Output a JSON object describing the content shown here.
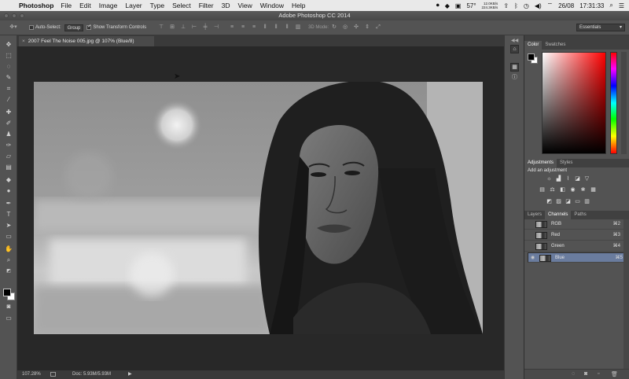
{
  "menubar": {
    "app_name": "Photoshop",
    "items": [
      "File",
      "Edit",
      "Image",
      "Layer",
      "Type",
      "Select",
      "Filter",
      "3D",
      "View",
      "Window",
      "Help"
    ],
    "temperature": "57°",
    "net_up": "12.0KB/s",
    "net_down": "224.3KB/s",
    "date": "26/08",
    "time": "17:31:33"
  },
  "window": {
    "title": "Adobe Photoshop CC 2014"
  },
  "options_bar": {
    "auto_select_label": "Auto-Select:",
    "auto_select_value": "Group",
    "show_transform_label": "Show Transform Controls",
    "mode_3d_label": "3D Mode:",
    "workspace": "Essentials"
  },
  "document": {
    "tab_title": "2007 Feel The Noise 005.jpg @ 107% (Blue/8)",
    "zoom": "107.28%",
    "doc_info": "Doc: 5.93M/5.93M"
  },
  "panels": {
    "color_tabs": [
      "Color",
      "Swatches"
    ],
    "adj_tabs": [
      "Adjustments",
      "Styles"
    ],
    "adj_header": "Add an adjustment",
    "channel_tabs": [
      "Layers",
      "Channels",
      "Paths"
    ],
    "channels": [
      {
        "name": "RGB",
        "shortcut": "⌘2"
      },
      {
        "name": "Red",
        "shortcut": "⌘3"
      },
      {
        "name": "Green",
        "shortcut": "⌘4"
      },
      {
        "name": "Blue",
        "shortcut": "⌘5"
      }
    ]
  }
}
